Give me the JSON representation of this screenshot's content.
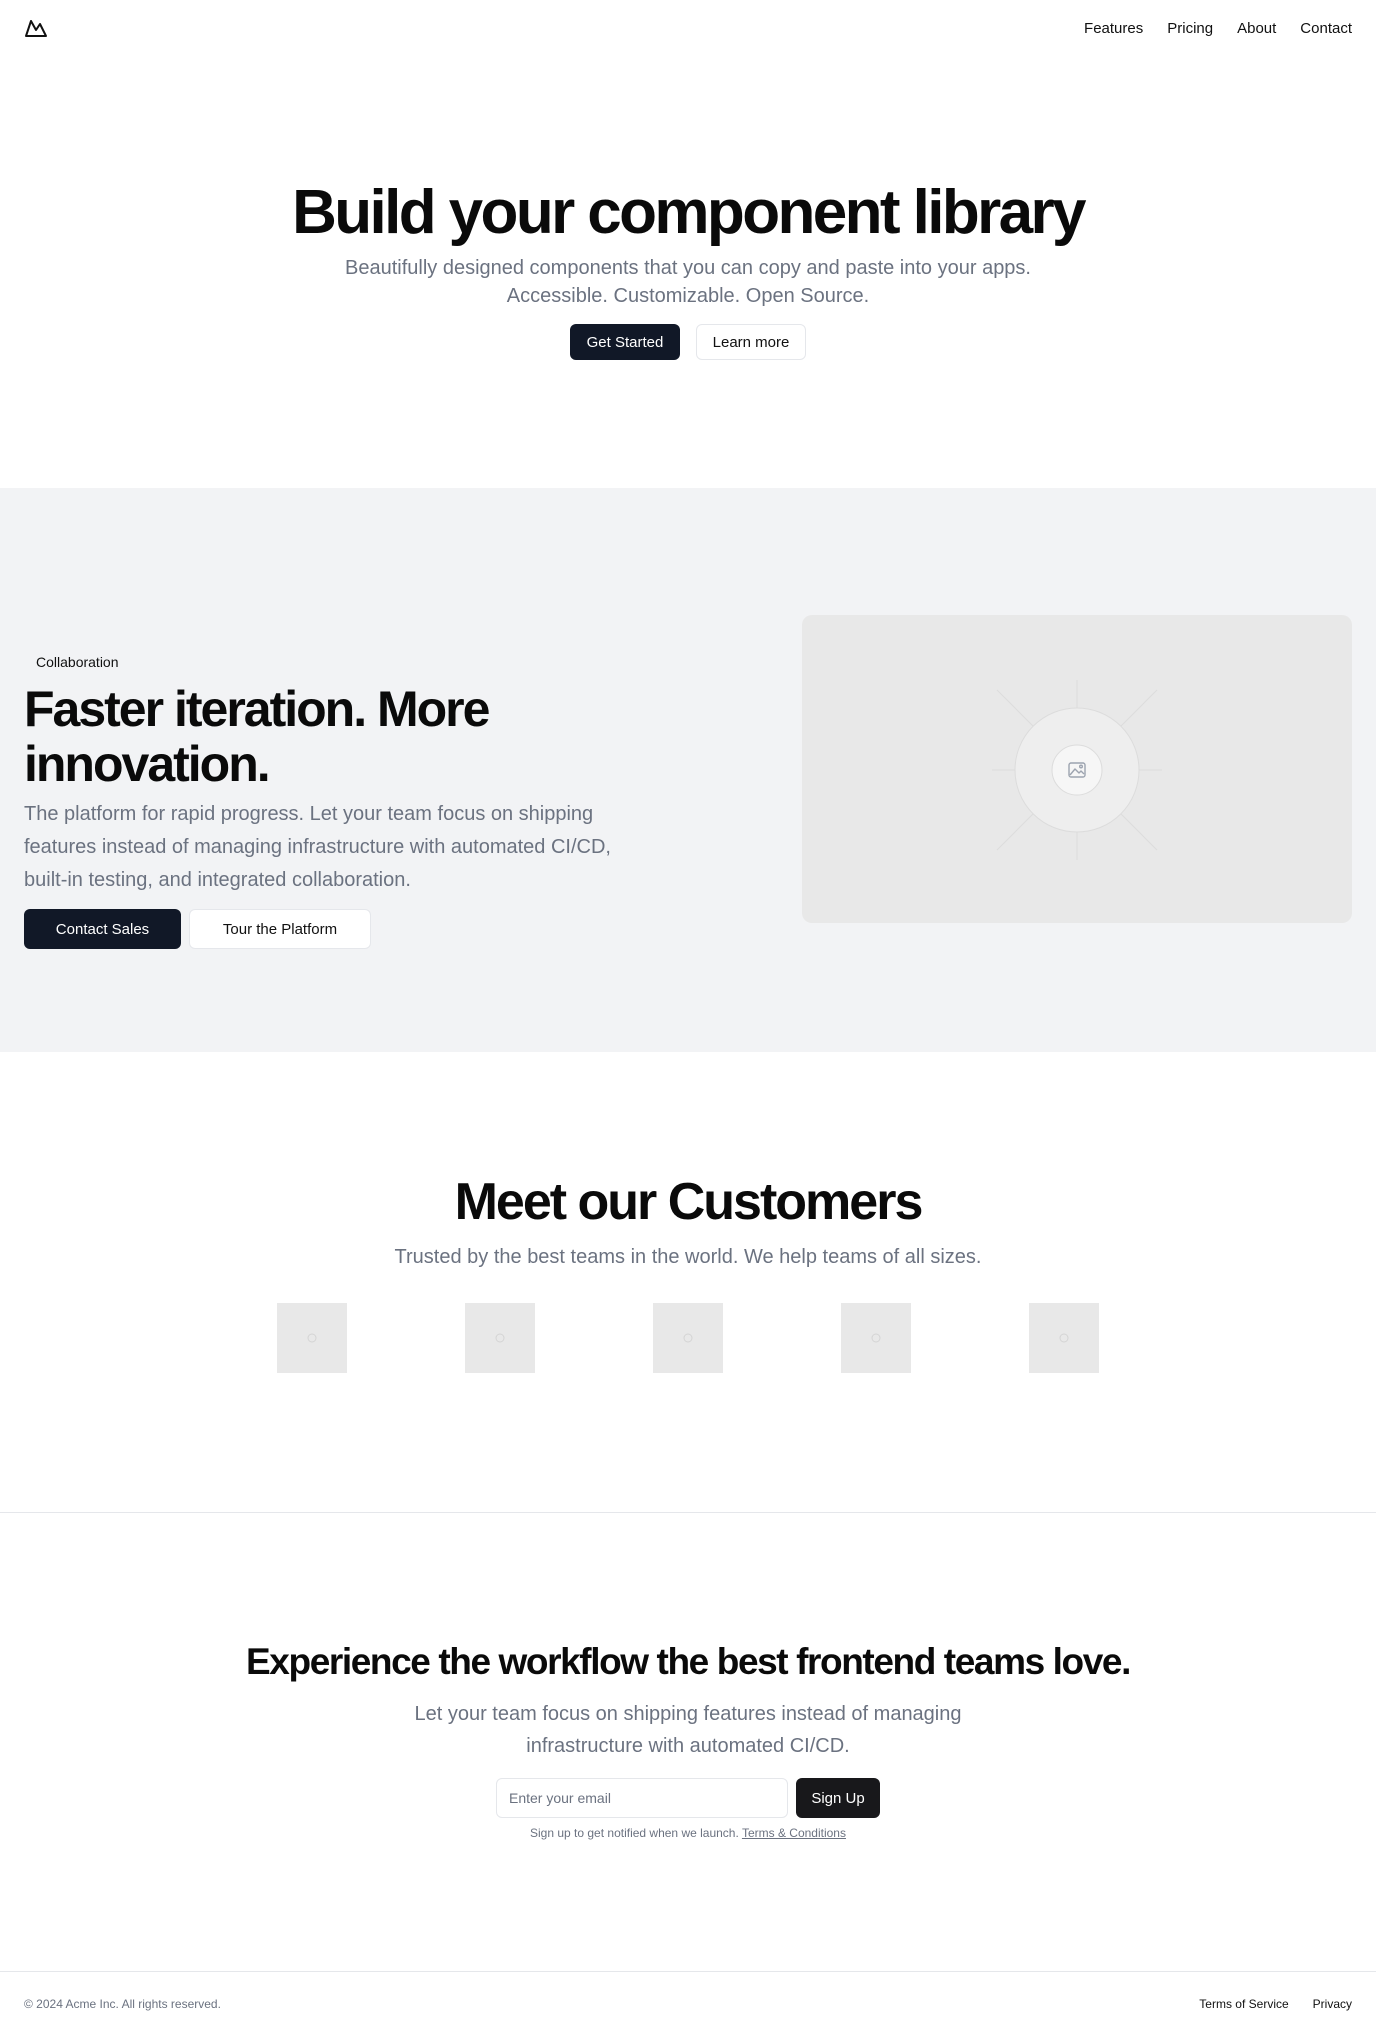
{
  "nav": {
    "logo_icon": "mountain-icon",
    "items": [
      "Features",
      "Pricing",
      "About",
      "Contact"
    ]
  },
  "hero": {
    "title": "Build your component library",
    "subtitle": "Beautifully designed components that you can copy and paste into your apps. Accessible. Customizable. Open Source.",
    "primary_label": "Get Started",
    "secondary_label": "Learn more"
  },
  "feature": {
    "badge": "Collaboration",
    "title": "Faster iteration. More innovation.",
    "description": "The platform for rapid progress. Let your team focus on shipping features instead of managing infrastructure with automated CI/CD, built-in testing, and integrated collaboration.",
    "primary_label": "Contact Sales",
    "secondary_label": "Tour the Platform",
    "image_icon": "image-placeholder-icon"
  },
  "customers": {
    "title": "Meet our Customers",
    "subtitle": "Trusted by the best teams in the world. We help teams of all sizes.",
    "logo_count": 5
  },
  "cta": {
    "title": "Experience the workflow the best frontend teams love.",
    "description": "Let your team focus on shipping features instead of managing infrastructure with automated CI/CD.",
    "email_placeholder": "Enter your email",
    "signup_label": "Sign Up",
    "fine_print": "Sign up to get notified when we launch.",
    "terms_link": "Terms & Conditions"
  },
  "footer": {
    "copyright": "© 2024 Acme Inc. All rights reserved.",
    "links": [
      "Terms of Service",
      "Privacy"
    ]
  },
  "colors": {
    "primary_button": "#111827",
    "muted_text": "#6b7280",
    "section_bg": "#f2f3f5",
    "placeholder_bg": "#e8e8e8"
  }
}
